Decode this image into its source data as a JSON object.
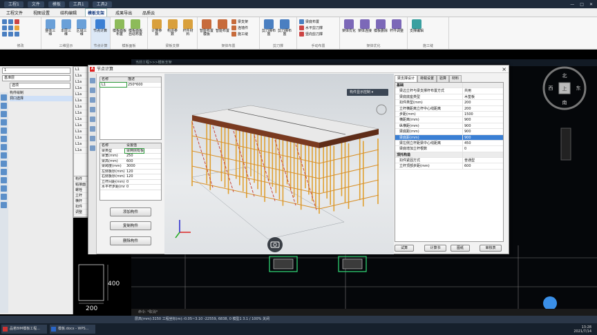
{
  "titlebar": {
    "tabs": [
      "工程1",
      "文件",
      "模板",
      "工具1",
      "工具2"
    ]
  },
  "menu": {
    "tabs": [
      "工程文件",
      "视图设置",
      "结构编辑",
      "模板支架",
      "成果导出",
      "品质云"
    ],
    "active_index": 3
  },
  "ribbon": {
    "groups": [
      {
        "name": "修改",
        "buttons": []
      },
      {
        "name": "三维显示",
        "buttons": [
          "整体三维",
          "本层三维",
          "区域三维"
        ]
      },
      {
        "name": "节点计算",
        "buttons": [
          "节点计算"
        ]
      },
      {
        "name": "模板面板",
        "buttons": [
          "模板面板布置",
          "模板面板自动布置"
        ]
      },
      {
        "name": "梁板支撑",
        "buttons": [
          "计算参数",
          "构造参数",
          "杆件材料"
        ]
      },
      {
        "name": "架体布置",
        "buttons": [
          "智能布置模板",
          "智能布置"
        ]
      },
      {
        "name": "剪刀撑",
        "buttons": [
          "剪刀撑布置",
          "剪刀撑布置"
        ]
      },
      {
        "name": "手动布置",
        "buttons": [
          "梁底布置",
          "水平剪刀撑",
          "竖向剪刀撑"
        ]
      },
      {
        "name": "架体优化",
        "buttons": [
          "架体优化",
          "架体连接",
          "模板删除",
          "杆件调整"
        ]
      },
      {
        "name": "施工缝",
        "buttons": [
          "支撑编辑"
        ]
      }
    ],
    "small_items": [
      "梁支架",
      "连墙件",
      "施工缝"
    ]
  },
  "docstrip": "当前工程>>>模板支架",
  "leftdock": {
    "dropdown1": "1",
    "dropdown2": "基准层",
    "dropdown3": "选项",
    "items": [
      "构件绘制",
      "洞口选择"
    ]
  },
  "list_panel": [
    "L1",
    "L1a",
    "L1a",
    "L1a",
    "L1a",
    "L1a",
    "L1a",
    "L1a",
    "L1a",
    "L1a",
    "L1a",
    "L1a",
    "L1a",
    "L1a"
  ],
  "prop_panel": [
    "构件",
    "粘接面",
    "螺栓",
    "立杆",
    "横杆",
    "扣件",
    "调整"
  ],
  "dialog": {
    "title": "节点计算",
    "section_table": {
      "headers": [
        "名称",
        "描述"
      ],
      "rows": [
        [
          "L1",
          "250*600"
        ]
      ]
    },
    "param_table": {
      "headers": [
        "名称",
        "设置值"
      ],
      "rows": [
        [
          "梁类型",
          "梁两侧有板"
        ],
        [
          "梁宽(mm)",
          "250"
        ],
        [
          "梁高(mm)",
          "600"
        ],
        [
          "梁跨度(mm)",
          "3000"
        ],
        [
          "左侧板厚(mm)",
          "120"
        ],
        [
          "右侧板厚(mm)",
          "120"
        ],
        [
          "立杆间距(mm)",
          "0"
        ],
        [
          "水平杆步距(mm)",
          "0"
        ]
      ]
    },
    "buttons": {
      "add": "添加构件",
      "copy": "复制构件",
      "delete": "删除构件"
    },
    "view_dropdown": "构件显示控制",
    "prop_tabs": [
      "梁支撑设计",
      "荷载设置",
      "验算",
      "材料"
    ],
    "props": [
      {
        "k": "基础",
        "v": "",
        "type": "group"
      },
      {
        "k": "梁边立杆与梁支撑杆布置方式",
        "v": "共用"
      },
      {
        "k": "梁底底座类型",
        "v": "木垫板"
      },
      {
        "k": "扣件类型(mm)",
        "v": "200"
      },
      {
        "k": "立杆横距离立杆中心线距离",
        "v": "200"
      },
      {
        "k": "步距(mm)",
        "v": "1500"
      },
      {
        "k": "横距离(mm)",
        "v": "900"
      },
      {
        "k": "纵横距(mm)",
        "v": "900"
      },
      {
        "k": "梁底距(mm)",
        "v": "900"
      },
      {
        "k": "梁底距(mm)",
        "v": "900",
        "type": "hl"
      },
      {
        "k": "梁左侧立杆距梁中心线距离",
        "v": "450"
      },
      {
        "k": "梁底增加立杆根数",
        "v": "0"
      },
      {
        "k": "顶托构造",
        "v": "",
        "type": "group"
      },
      {
        "k": "扣件紧固方式",
        "v": "普通型"
      },
      {
        "k": "立杆顶部步距(mm)",
        "v": "600"
      }
    ],
    "bottom_buttons": [
      "试算",
      "计算书",
      "图纸",
      "审核表"
    ]
  },
  "drawing": {
    "dim_left": "400",
    "dim_bottom": "200"
  },
  "compass": {
    "north": "北",
    "south": "南",
    "east": "东",
    "west": "西",
    "center": "上"
  },
  "cmdline": "命令: *取消*",
  "statusbar": "层高(mm):3150 工程坐标(m):-0.05~3.10      -22559, 6838, 0      模型1      3.1 / 100%      关闭",
  "taskbar": {
    "items": [
      "品茗BIM模板工程...",
      "模板.docx - WPS..."
    ],
    "time": "13:28",
    "date": "2021/7/14"
  },
  "colors": {
    "accent": "#3a7fd4",
    "green": "#2c9a3a",
    "dialog_bg": "#f2f2f2"
  }
}
